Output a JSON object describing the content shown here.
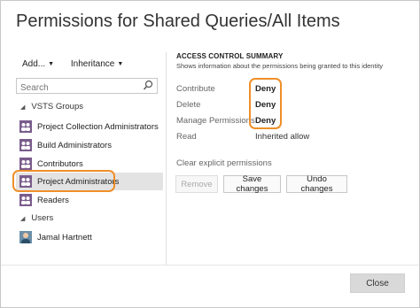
{
  "dialog": {
    "title": "Permissions for Shared Queries/All Items"
  },
  "toolbar": {
    "add_label": "Add...",
    "inheritance_label": "Inheritance"
  },
  "search": {
    "placeholder": "Search"
  },
  "tree": {
    "groups_header": "VSTS Groups",
    "groups": [
      {
        "label": "Project Collection Administrators"
      },
      {
        "label": "Build Administrators"
      },
      {
        "label": "Contributors"
      },
      {
        "label": "Project Administrators",
        "selected": true
      },
      {
        "label": "Readers"
      }
    ],
    "users_header": "Users",
    "users": [
      {
        "label": "Jamal Hartnett"
      }
    ]
  },
  "access_summary": {
    "title": "ACCESS CONTROL SUMMARY",
    "subtitle": "Shows information about the permissions being granted to this identity",
    "permissions": [
      {
        "name": "Contribute",
        "value": "Deny"
      },
      {
        "name": "Delete",
        "value": "Deny"
      },
      {
        "name": "Manage Permissions",
        "value": "Deny"
      },
      {
        "name": "Read",
        "value": "Inherited allow"
      }
    ],
    "clear_link": "Clear explicit permissions"
  },
  "actions": {
    "remove_label": "Remove",
    "save_label": "Save changes",
    "undo_label": "Undo changes",
    "close_label": "Close"
  },
  "colors": {
    "highlight": "#ef8f2a",
    "group_icon": "#7a5c8c",
    "selected_row": "#e3e3e3"
  }
}
